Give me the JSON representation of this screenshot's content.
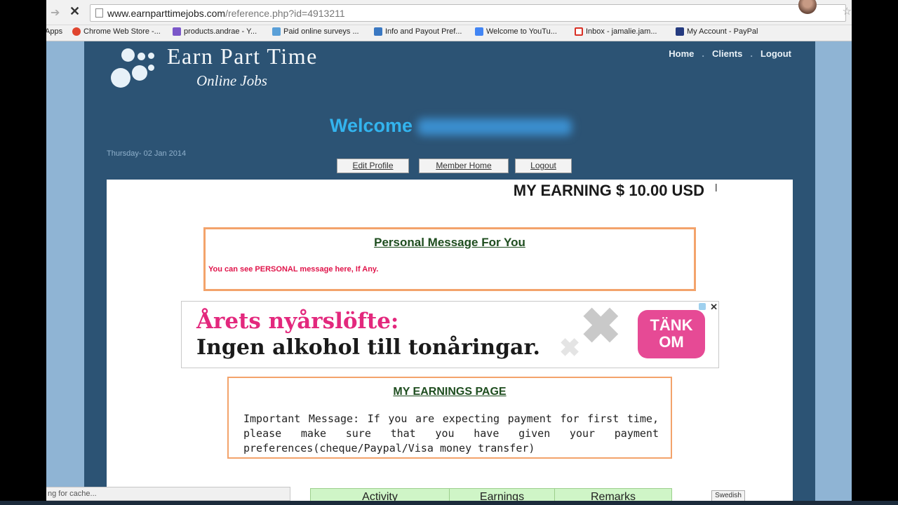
{
  "browser": {
    "url_host": "www.earnparttimejobs.com",
    "url_path": "/reference.php?id=4913211",
    "bookmarks": [
      {
        "label": "Apps",
        "color": "#4a7bd0"
      },
      {
        "label": "Chrome Web Store -...",
        "color": "#e0452f"
      },
      {
        "label": "products.andrae - Y...",
        "color": "#7b57c9"
      },
      {
        "label": "Paid online surveys ...",
        "color": "#5aa0d8"
      },
      {
        "label": "Info and Payout Pref...",
        "color": "#3a78c2"
      },
      {
        "label": "Welcome to YouTu...",
        "color": "#4285f4"
      },
      {
        "label": "Inbox - jamalie.jam...",
        "color": "#d93025"
      },
      {
        "label": "My Account - PayPal",
        "color": "#253b80"
      }
    ],
    "status_text": "ng for cache...",
    "language_button": "Swedish"
  },
  "site": {
    "logo_main": "Earn Part Time",
    "logo_sub": "Online Jobs",
    "nav": [
      "Home",
      "Clients",
      "Logout"
    ],
    "nav_separator": ".",
    "welcome": "Welcome",
    "date": "Thursday- 02 Jan 2014",
    "buttons": {
      "edit_profile": "Edit Profile",
      "member_home": "Member Home",
      "logout": "Logout"
    },
    "earning": "MY EARNING $ 10.00 USD",
    "personal_box": {
      "title": "Personal Message For You",
      "message": "You can see PERSONAL message here, If Any."
    },
    "ad": {
      "line1": "Årets nyårslöfte:",
      "line2": "Ingen alkohol till tonåringar.",
      "badge_line1": "TÄNK",
      "badge_line2": "OM",
      "accent": "#e3287d"
    },
    "earnings_box": {
      "title": "MY EARNINGS PAGE",
      "message": "Important Message: If you are expecting payment for first time, please make sure that you have given your payment preferences(cheque/Paypal/Visa money transfer)"
    },
    "table_headers": [
      "Activity",
      "Earnings",
      "Remarks"
    ]
  }
}
